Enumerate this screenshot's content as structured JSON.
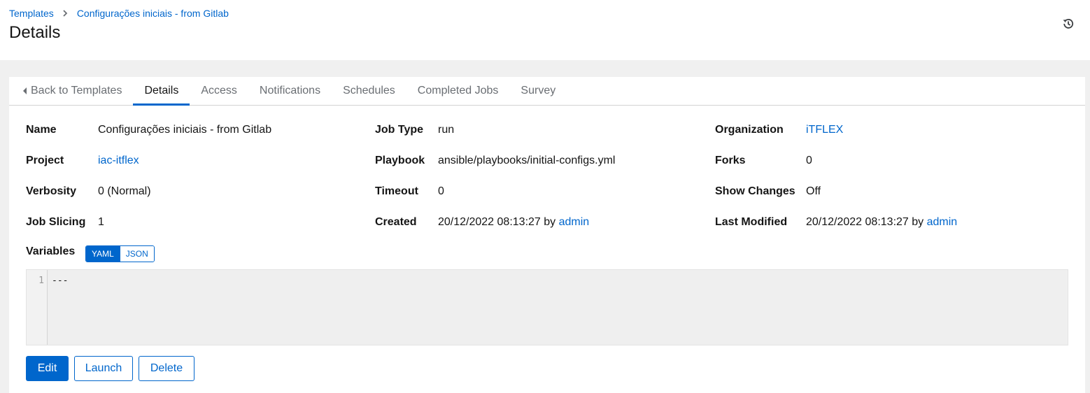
{
  "breadcrumb": {
    "items": [
      {
        "label": "Templates"
      },
      {
        "label": "Configurações iniciais - from Gitlab"
      }
    ]
  },
  "page": {
    "title": "Details",
    "history_icon": "history-icon"
  },
  "tabs": [
    {
      "label": "Back to Templates",
      "active": false
    },
    {
      "label": "Details",
      "active": true
    },
    {
      "label": "Access",
      "active": false
    },
    {
      "label": "Notifications",
      "active": false
    },
    {
      "label": "Schedules",
      "active": false
    },
    {
      "label": "Completed Jobs",
      "active": false
    },
    {
      "label": "Survey",
      "active": false
    }
  ],
  "details": {
    "name": {
      "label": "Name",
      "value": "Configurações iniciais - from Gitlab"
    },
    "job_type": {
      "label": "Job Type",
      "value": "run"
    },
    "organization": {
      "label": "Organization",
      "value": "iTFLEX"
    },
    "project": {
      "label": "Project",
      "value": "iac-itflex"
    },
    "playbook": {
      "label": "Playbook",
      "value": "ansible/playbooks/initial-configs.yml"
    },
    "forks": {
      "label": "Forks",
      "value": "0"
    },
    "verbosity": {
      "label": "Verbosity",
      "value": "0 (Normal)"
    },
    "timeout": {
      "label": "Timeout",
      "value": "0"
    },
    "show_changes": {
      "label": "Show Changes",
      "value": "Off"
    },
    "job_slicing": {
      "label": "Job Slicing",
      "value": "1"
    },
    "created": {
      "label": "Created",
      "date": "20/12/2022 08:13:27",
      "by": "by",
      "user": "admin"
    },
    "last_modified": {
      "label": "Last Modified",
      "date": "20/12/2022 08:13:27",
      "by": "by",
      "user": "admin"
    }
  },
  "variables": {
    "label": "Variables",
    "modes": [
      "YAML",
      "JSON"
    ],
    "selected_mode": "YAML",
    "lines": [
      {
        "number": "1",
        "text": "---"
      }
    ]
  },
  "actions": {
    "edit": "Edit",
    "launch": "Launch",
    "delete": "Delete"
  },
  "colors": {
    "accent": "#0066cc",
    "page_background": "#f0f0f0",
    "text": "#151515",
    "muted_text": "#6a6e73"
  }
}
